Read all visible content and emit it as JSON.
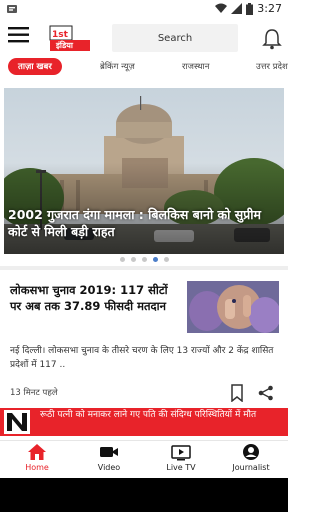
{
  "status_bar": {
    "time": "3:27"
  },
  "header": {
    "logo_text": "इंडिया",
    "search_label": "Search"
  },
  "tabs": [
    {
      "label": "ताज़ा खबर",
      "active": true
    },
    {
      "label": "ब्रेकिंग न्यूज़",
      "active": false
    },
    {
      "label": "राजस्थान",
      "active": false
    },
    {
      "label": "उत्तर प्रदेश",
      "active": false
    }
  ],
  "hero": {
    "caption": "2002 गुजरात दंगा मामला : बिलकिस बानो को सुप्रीम कोर्ट से मिली बड़ी राहत",
    "dots_total": 5,
    "dots_active": 3
  },
  "story": {
    "title": "लोकसभा चुनाव 2019: 117 सीटों पर अब तक 37.89 फीसदी मतदान",
    "body": "नई दिल्ली। लोकसभा चुनाव के तीसरे चरण के लिए 13 राज्यों और 2 केंद्र शासित प्रदेशों में 117 ..",
    "time": "13 मिनट पहले"
  },
  "ticker": {
    "text": "रूठी पत्नी को मनाकर लाने गए पति की संदिग्ध परिस्थितियों में मौत"
  },
  "bottom_nav": [
    {
      "label": "Home",
      "icon": "home-icon",
      "active": true
    },
    {
      "label": "Video",
      "icon": "video-camera-icon",
      "active": false
    },
    {
      "label": "Live TV",
      "icon": "tv-icon",
      "active": false
    },
    {
      "label": "Journalist",
      "icon": "journalist-icon",
      "active": false
    }
  ],
  "colors": {
    "accent": "#e8232a",
    "dot_active": "#4a7dc8"
  }
}
